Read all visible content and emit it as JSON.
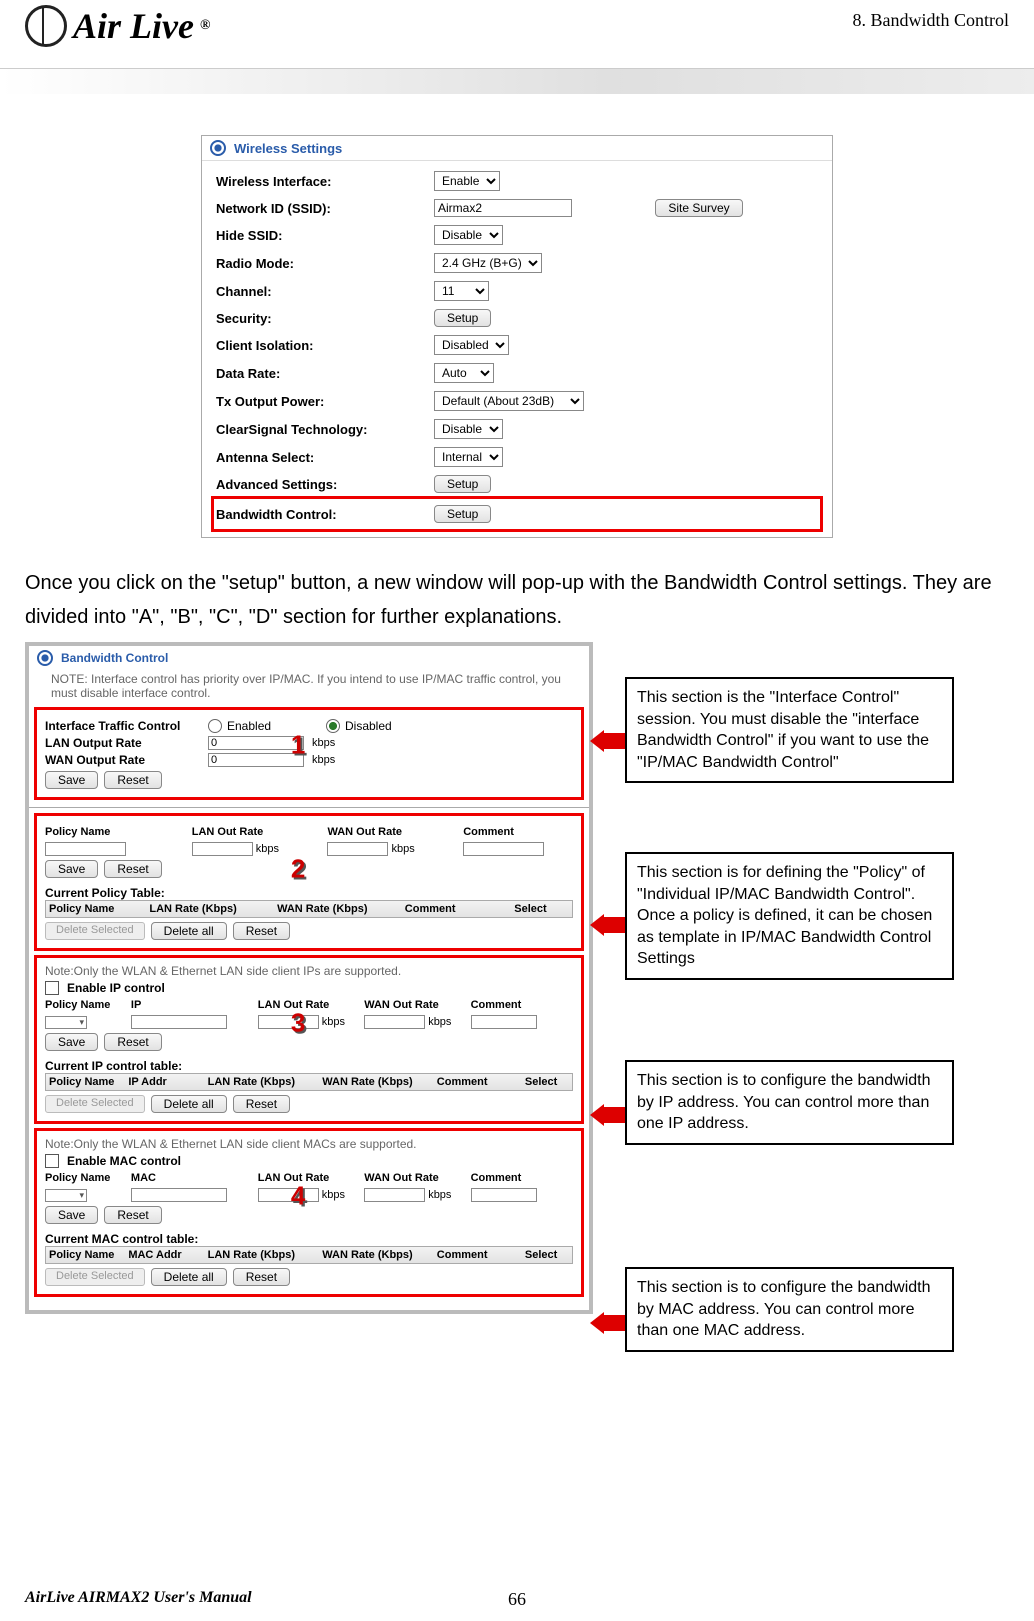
{
  "header": {
    "chapter": "8. Bandwidth Control",
    "logo_text": "Air Live",
    "logo_mark": "®"
  },
  "wireless_settings": {
    "title": "Wireless Settings",
    "rows": {
      "wireless_interface": {
        "label": "Wireless Interface:",
        "value": "Enable"
      },
      "ssid": {
        "label": "Network ID (SSID):",
        "value": "Airmax2",
        "site_survey": "Site Survey"
      },
      "hide_ssid": {
        "label": "Hide SSID:",
        "value": "Disable"
      },
      "radio_mode": {
        "label": "Radio Mode:",
        "value": "2.4 GHz (B+G)"
      },
      "channel": {
        "label": "Channel:",
        "value": "11"
      },
      "security": {
        "label": "Security:",
        "button": "Setup"
      },
      "client_isolation": {
        "label": "Client Isolation:",
        "value": "Disabled"
      },
      "data_rate": {
        "label": "Data Rate:",
        "value": "Auto"
      },
      "tx_power": {
        "label": "Tx Output Power:",
        "value": "Default (About 23dB)"
      },
      "clearsignal": {
        "label": "ClearSignal Technology:",
        "value": "Disable"
      },
      "antenna": {
        "label": "Antenna Select:",
        "value": "Internal"
      },
      "advanced": {
        "label": "Advanced Settings:",
        "button": "Setup"
      },
      "bandwidth": {
        "label": "Bandwidth Control:",
        "button": "Setup"
      }
    }
  },
  "paragraph": "Once you click on the \"setup\" button, a new window will pop-up with the Bandwidth Control settings.    They are divided into \"A\", \"B\", \"C\", \"D\" section for further explanations.",
  "bwc": {
    "title": "Bandwidth Control",
    "note": "NOTE: Interface control has priority over IP/MAC. If you intend to use IP/MAC traffic control, you must disable interface control.",
    "section1": {
      "number": "1",
      "itc": "Interface Traffic Control",
      "enabled": "Enabled",
      "disabled": "Disabled",
      "lan_out": "LAN Output Rate",
      "wan_out": "WAN Output Rate",
      "zero": "0",
      "kbps": "kbps",
      "save": "Save",
      "reset": "Reset"
    },
    "section2": {
      "number": "2",
      "hdr": {
        "name": "Policy Name",
        "lan": "LAN Out Rate",
        "wan": "WAN Out Rate",
        "comment": "Comment"
      },
      "kbps": "kbps",
      "save": "Save",
      "reset": "Reset",
      "cpt": "Current Policy Table:",
      "thdr": {
        "name": "Policy Name",
        "lan": "LAN Rate (Kbps)",
        "wan": "WAN Rate (Kbps)",
        "comment": "Comment",
        "select": "Select"
      },
      "del_sel": "Delete Selected",
      "del_all": "Delete all",
      "reset2": "Reset"
    },
    "section3": {
      "number": "3",
      "note": "Note:Only the WLAN & Ethernet LAN side client IPs are supported.",
      "enable": "Enable IP control",
      "hdr": {
        "name": "Policy Name",
        "ip": "IP",
        "lan": "LAN Out Rate",
        "wan": "WAN Out Rate",
        "comment": "Comment"
      },
      "kbps": "kbps",
      "save": "Save",
      "reset": "Reset",
      "cpt": "Current IP control table:",
      "thdr": {
        "name": "Policy Name",
        "ip": "IP Addr",
        "lan": "LAN Rate (Kbps)",
        "wan": "WAN Rate (Kbps)",
        "comment": "Comment",
        "select": "Select"
      },
      "del_sel": "Delete Selected",
      "del_all": "Delete all",
      "reset2": "Reset"
    },
    "section4": {
      "number": "4",
      "note": "Note:Only the WLAN & Ethernet LAN side client MACs are supported.",
      "enable": "Enable MAC control",
      "hdr": {
        "name": "Policy Name",
        "mac": "MAC",
        "lan": "LAN Out Rate",
        "wan": "WAN Out Rate",
        "comment": "Comment"
      },
      "kbps": "kbps",
      "save": "Save",
      "reset": "Reset",
      "cpt": "Current MAC control table:",
      "thdr": {
        "name": "Policy Name",
        "mac": "MAC Addr",
        "lan": "LAN Rate (Kbps)",
        "wan": "WAN Rate (Kbps)",
        "comment": "Comment",
        "select": "Select"
      },
      "del_sel": "Delete Selected",
      "del_all": "Delete all",
      "reset2": "Reset"
    }
  },
  "callouts": {
    "c1": "This section is the \"Interface Control\" session.    You must disable the \"interface Bandwidth Control\" if you want to use the \"IP/MAC Bandwidth Control\"",
    "c2": "This section is for defining the \"Policy\" of \"Individual IP/MAC Bandwidth Control\".    Once a policy is defined, it can be chosen as template in IP/MAC Bandwidth Control Settings",
    "c3": "This section is to configure the bandwidth by IP address.    You can control more than one IP address.",
    "c4": "This section is to configure the bandwidth by MAC address. You can control more than one MAC address."
  },
  "footer": {
    "left": "AirLive AIRMAX2 User's Manual",
    "page": "66"
  }
}
